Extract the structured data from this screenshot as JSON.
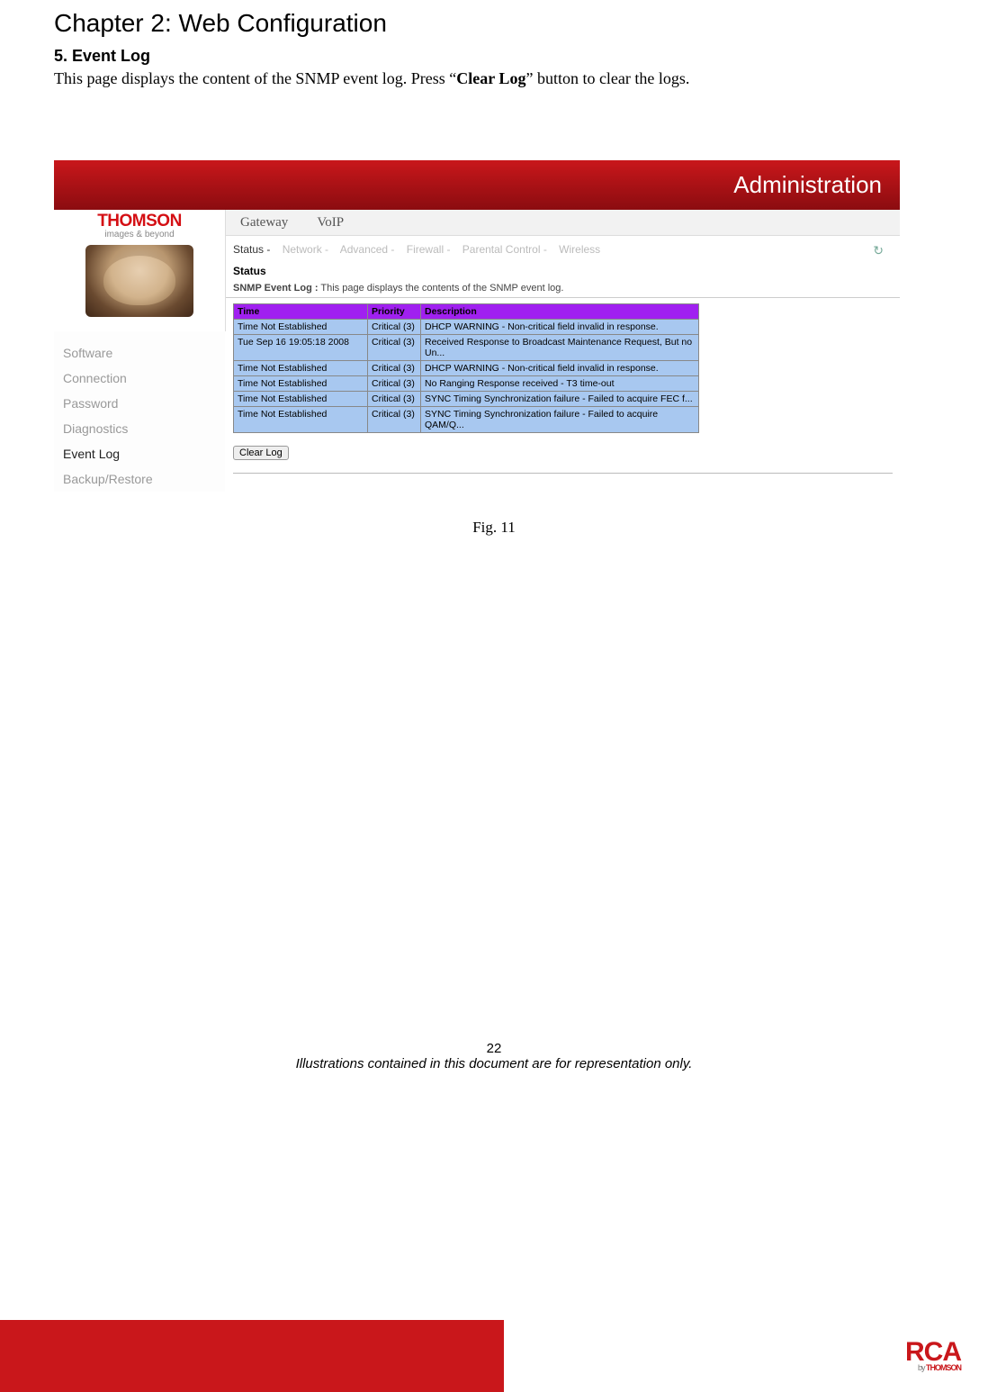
{
  "chapter_title": "Chapter 2: Web Configuration",
  "section_title": "5. Event Log",
  "body_text_prefix": "This page displays the content of the SNMP event log. Press “",
  "body_text_bold": "Clear Log",
  "body_text_suffix": "” button to clear the logs.",
  "figure_caption": "Fig. 11",
  "page_number": "22",
  "disclaimer": "Illustrations contained in this document are for representation only.",
  "screenshot": {
    "brand": "THOMSON",
    "tagline": "images & beyond",
    "top_label": "Administration",
    "top_tabs": [
      "Gateway",
      "VoIP"
    ],
    "sub_tabs": [
      "Status -",
      "Network -",
      "Advanced -",
      "Firewall -",
      "Parental Control -",
      "Wireless"
    ],
    "refresh_icon": "↻",
    "sidebar": [
      "Software",
      "Connection",
      "Password",
      "Diagnostics",
      "Event Log",
      "Backup/Restore"
    ],
    "sidebar_active_index": 4,
    "status_heading": "Status",
    "status_desc_label": "SNMP Event Log :",
    "status_desc_text": "This page displays the contents of the SNMP event log.",
    "table_headers": [
      "Time",
      "Priority",
      "Description"
    ],
    "rows": [
      {
        "time": "Time Not Established",
        "prio": "Critical (3)",
        "desc": " DHCP WARNING - Non-critical field invalid in response."
      },
      {
        "time": "Tue Sep 16 19:05:18 2008",
        "prio": "Critical (3)",
        "desc": " Received Response to Broadcast Maintenance Request, But no Un..."
      },
      {
        "time": "Time Not Established",
        "prio": "Critical (3)",
        "desc": " DHCP WARNING - Non-critical field invalid in response."
      },
      {
        "time": "Time Not Established",
        "prio": "Critical (3)",
        "desc": " No Ranging Response received - T3 time-out"
      },
      {
        "time": "Time Not Established",
        "prio": "Critical (3)",
        "desc": " SYNC Timing Synchronization failure - Failed to acquire FEC f..."
      },
      {
        "time": "Time Not Established",
        "prio": "Critical (3)",
        "desc": " SYNC Timing Synchronization failure - Failed to acquire QAM/Q..."
      }
    ],
    "clear_button": "Clear Log"
  },
  "footer_logo": {
    "brand": "RCA",
    "by": "by ",
    "maker": "THOMSON"
  }
}
